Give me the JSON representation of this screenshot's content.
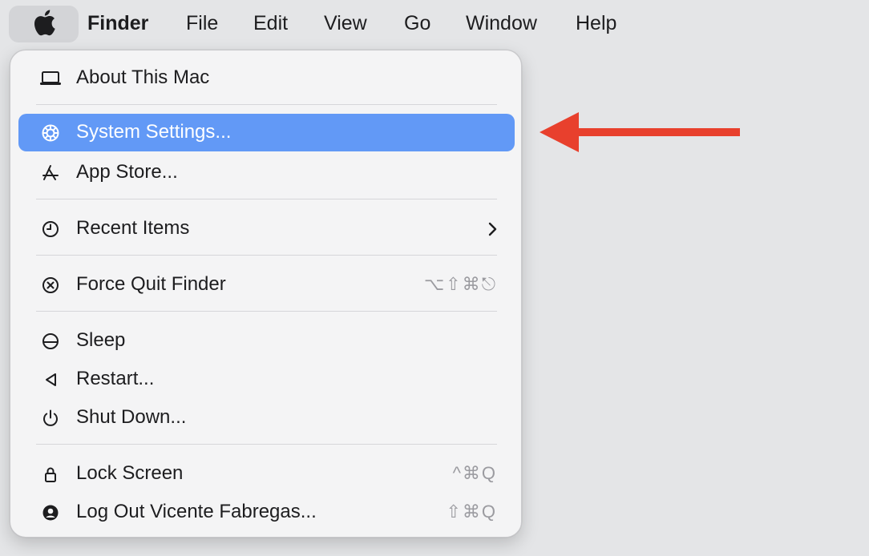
{
  "menubar": {
    "apple_icon": "apple-logo-icon",
    "items": [
      {
        "label": "Finder"
      },
      {
        "label": "File"
      },
      {
        "label": "Edit"
      },
      {
        "label": "View"
      },
      {
        "label": "Go"
      },
      {
        "label": "Window"
      },
      {
        "label": "Help"
      }
    ]
  },
  "apple_menu": {
    "items": [
      {
        "label": "About This Mac",
        "icon": "laptop-icon",
        "shortcut": ""
      },
      {
        "label": "System Settings...",
        "icon": "gear-icon",
        "shortcut": "",
        "highlighted": true
      },
      {
        "label": "App Store...",
        "icon": "app-store-icon",
        "shortcut": ""
      },
      {
        "label": "Recent Items",
        "icon": "clock-icon",
        "shortcut": "",
        "submenu": true
      },
      {
        "label": "Force Quit Finder",
        "icon": "force-quit-icon",
        "shortcut": "⌥⇧⌘⎋"
      },
      {
        "label": "Sleep",
        "icon": "sleep-icon",
        "shortcut": ""
      },
      {
        "label": "Restart...",
        "icon": "restart-icon",
        "shortcut": ""
      },
      {
        "label": "Shut Down...",
        "icon": "power-icon",
        "shortcut": ""
      },
      {
        "label": "Lock Screen",
        "icon": "lock-icon",
        "shortcut": "^⌘Q"
      },
      {
        "label": "Log Out Vicente Fabregas...",
        "icon": "user-icon",
        "shortcut": "⇧⌘Q"
      }
    ]
  },
  "colors": {
    "highlight": "#6299f6",
    "arrow": "#e8402d",
    "background": "#e4e5e7"
  }
}
